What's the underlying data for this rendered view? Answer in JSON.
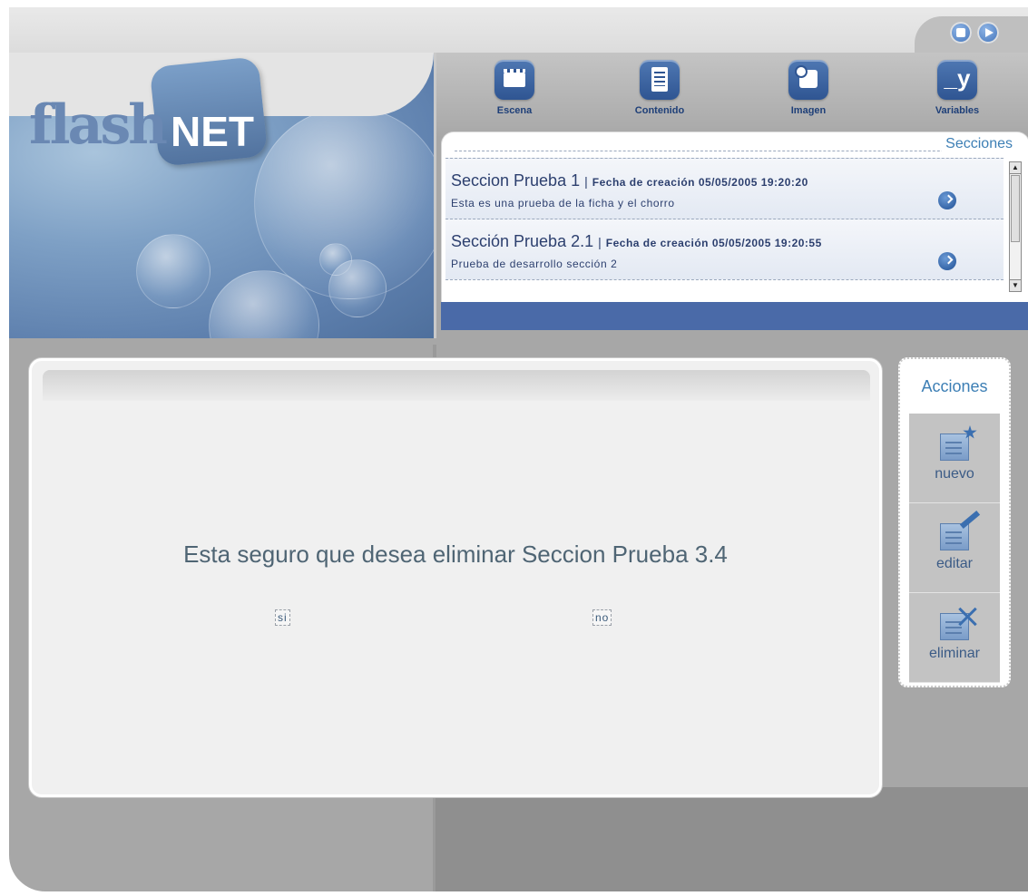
{
  "logo": {
    "part1": "flash",
    "part2": "NET"
  },
  "window_controls": [
    {
      "name": "stop-icon"
    },
    {
      "name": "play-icon"
    }
  ],
  "toolbar": {
    "items": [
      {
        "label": "Escena",
        "icon": "clapperboard-icon"
      },
      {
        "label": "Contenido",
        "icon": "document-icon"
      },
      {
        "label": "Imagen",
        "icon": "image-icon"
      },
      {
        "label": "Variables",
        "icon": "variables-icon",
        "glyph": "_y"
      }
    ]
  },
  "sections": {
    "title": "Secciones",
    "separator": "|",
    "items": [
      {
        "name": "Seccion Prueba 1",
        "date_label": "Fecha de creación 05/05/2005 19:20:20",
        "description": "Esta es una prueba de la ficha y el chorro"
      },
      {
        "name": "Sección Prueba 2.1",
        "date_label": "Fecha de creación 05/05/2005 19:20:55",
        "description": "Prueba de desarrollo sección 2"
      }
    ]
  },
  "dialog": {
    "message": "Esta seguro que desea eliminar Seccion Prueba 3.4",
    "yes_label": "si",
    "no_label": "no"
  },
  "actions": {
    "title": "Acciones",
    "items": [
      {
        "label": "nuevo",
        "icon": "new-document-icon"
      },
      {
        "label": "editar",
        "icon": "edit-document-icon"
      },
      {
        "label": "eliminar",
        "icon": "delete-document-icon"
      }
    ]
  },
  "colors": {
    "accent_blue": "#2f5592",
    "band_blue": "#4a6aa8",
    "title_blue": "#3d7fb5",
    "panel_gray": "#a7a7a7"
  }
}
